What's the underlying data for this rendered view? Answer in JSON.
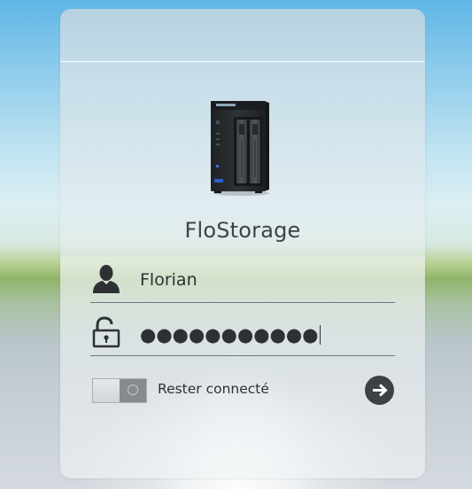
{
  "device": {
    "name": "FloStorage",
    "brand_logo": "asustor"
  },
  "login": {
    "username": "Florian",
    "password_masked": "●●●●●●●●●●●",
    "remember_label": "Rester connecté",
    "remember_checked": false
  },
  "icons": {
    "user": "user-icon",
    "lock": "unlocked-padlock-icon",
    "submit": "arrow-right-icon"
  },
  "colors": {
    "text": "#2d3134",
    "button": "#3c4146",
    "field_line": "#6f757a"
  }
}
